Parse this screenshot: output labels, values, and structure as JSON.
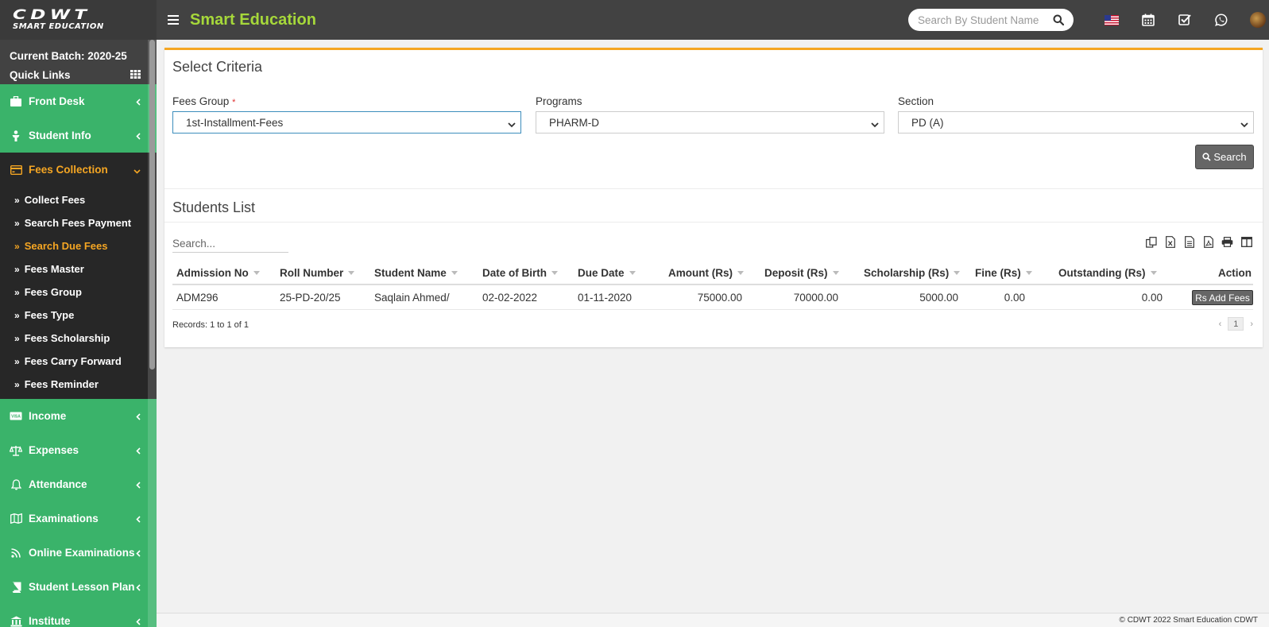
{
  "header": {
    "logo_line1": "CDWT",
    "logo_line2": "SMART EDUCATION",
    "title": "Smart Education",
    "search_placeholder": "Search By Student Name",
    "icons": [
      "menu-icon",
      "search-icon",
      "us-flag-icon",
      "calendar-icon",
      "task-check-icon",
      "whatsapp-icon",
      "user-avatar"
    ]
  },
  "sidebar": {
    "batch": "Current Batch: 2020-25",
    "quick_links": "Quick Links",
    "items_top": [
      {
        "label": "Front Desk",
        "icon": "briefcase-icon"
      },
      {
        "label": "Student Info",
        "icon": "user-icon"
      }
    ],
    "active": {
      "label": "Fees Collection",
      "icon": "credit-card-icon"
    },
    "sub_items": [
      {
        "label": "Collect Fees"
      },
      {
        "label": "Search Fees Payment"
      },
      {
        "label": "Search Due Fees",
        "active": true
      },
      {
        "label": "Fees Master"
      },
      {
        "label": "Fees Group"
      },
      {
        "label": "Fees Type"
      },
      {
        "label": "Fees Scholarship"
      },
      {
        "label": "Fees Carry Forward"
      },
      {
        "label": "Fees Reminder"
      }
    ],
    "items_bottom": [
      {
        "label": "Income",
        "icon": "visa-card-icon"
      },
      {
        "label": "Expenses",
        "icon": "balance-scale-icon"
      },
      {
        "label": "Attendance",
        "icon": "bell-icon"
      },
      {
        "label": "Examinations",
        "icon": "map-icon"
      },
      {
        "label": "Online Examinations",
        "icon": "rss-icon"
      },
      {
        "label": "Student Lesson Plan",
        "icon": "book-icon"
      },
      {
        "label": "Institute",
        "icon": "bank-icon"
      }
    ]
  },
  "criteria": {
    "title": "Select Criteria",
    "fees_group_label": "Fees Group",
    "required_mark": "*",
    "fees_group_value": "1st-Installment-Fees",
    "programs_label": "Programs",
    "programs_value": "PHARM-D",
    "section_label": "Section",
    "section_value": "PD (A)",
    "search_button": "Search"
  },
  "students": {
    "title": "Students List",
    "search_placeholder": "Search...",
    "export_icons": [
      "copy-icon",
      "excel-icon",
      "csv-icon",
      "pdf-icon",
      "print-icon",
      "columns-icon"
    ],
    "columns": [
      "Admission No",
      "Roll Number",
      "Student Name",
      "Date of Birth",
      "Due Date",
      "Amount (Rs)",
      "Deposit (Rs)",
      "Scholarship (Rs)",
      "Fine (Rs)",
      "Outstanding (Rs)",
      "Action"
    ],
    "rows": [
      {
        "admission_no": "ADM296",
        "roll_number": "25-PD-20/25",
        "student_name": "Saqlain Ahmed/",
        "dob": "02-02-2022",
        "due_date": "01-11-2020",
        "amount": "75000.00",
        "deposit": "70000.00",
        "scholarship": "5000.00",
        "fine": "0.00",
        "outstanding": "0.00",
        "action": "Rs Add Fees"
      }
    ],
    "records_text": "Records: 1 to 1 of 1",
    "current_page": "1"
  },
  "footer": {
    "text": "© CDWT 2022 Smart Education CDWT"
  },
  "colors": {
    "sidebar": "#3ab36a",
    "header": "#424242",
    "accent": "#f5a623",
    "title_green": "#a6d83a"
  }
}
